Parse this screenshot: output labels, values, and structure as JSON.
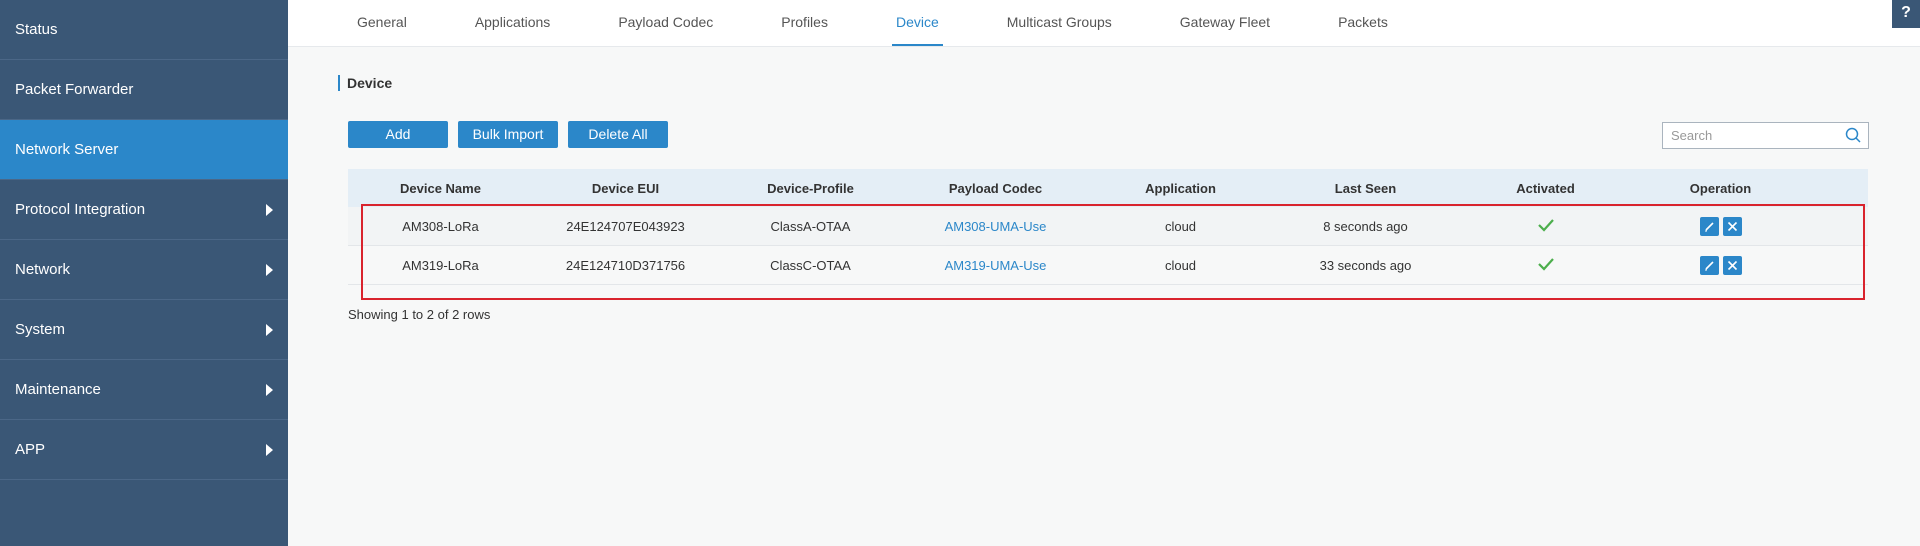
{
  "sidebar": {
    "items": [
      {
        "label": "Status",
        "has_arrow": false,
        "active": false
      },
      {
        "label": "Packet Forwarder",
        "has_arrow": false,
        "active": false
      },
      {
        "label": "Network Server",
        "has_arrow": false,
        "active": true
      },
      {
        "label": "Protocol Integration",
        "has_arrow": true,
        "active": false
      },
      {
        "label": "Network",
        "has_arrow": true,
        "active": false
      },
      {
        "label": "System",
        "has_arrow": true,
        "active": false
      },
      {
        "label": "Maintenance",
        "has_arrow": true,
        "active": false
      },
      {
        "label": "APP",
        "has_arrow": true,
        "active": false
      }
    ]
  },
  "tabs": [
    {
      "label": "General",
      "active": false
    },
    {
      "label": "Applications",
      "active": false
    },
    {
      "label": "Payload Codec",
      "active": false
    },
    {
      "label": "Profiles",
      "active": false
    },
    {
      "label": "Device",
      "active": true
    },
    {
      "label": "Multicast Groups",
      "active": false
    },
    {
      "label": "Gateway Fleet",
      "active": false
    },
    {
      "label": "Packets",
      "active": false
    }
  ],
  "help_label": "?",
  "section_title": "Device",
  "toolbar": {
    "add_label": "Add",
    "bulk_import_label": "Bulk Import",
    "delete_all_label": "Delete All"
  },
  "search": {
    "placeholder": "Search",
    "value": ""
  },
  "table": {
    "columns": [
      "Device Name",
      "Device EUI",
      "Device-Profile",
      "Payload Codec",
      "Application",
      "Last Seen",
      "Activated",
      "Operation"
    ],
    "rows": [
      {
        "name": "AM308-LoRa",
        "eui": "24E124707E043923",
        "profile": "ClassA-OTAA",
        "codec": "AM308-UMA-Use",
        "application": "cloud",
        "last_seen": "8 seconds ago",
        "activated": true
      },
      {
        "name": "AM319-LoRa",
        "eui": "24E124710D371756",
        "profile": "ClassC-OTAA",
        "codec": "AM319-UMA-Use",
        "application": "cloud",
        "last_seen": "33 seconds ago",
        "activated": true
      }
    ]
  },
  "footer": {
    "pagination_text": "Showing 1 to 2 of 2 rows"
  },
  "colors": {
    "accent": "#2b87c9",
    "sidebar": "#3a5776",
    "check": "#4cae4c",
    "highlight": "#d9232d"
  },
  "icons": {
    "activated": "check-icon",
    "edit": "pencil-icon",
    "delete": "close-icon",
    "search": "search-icon"
  }
}
